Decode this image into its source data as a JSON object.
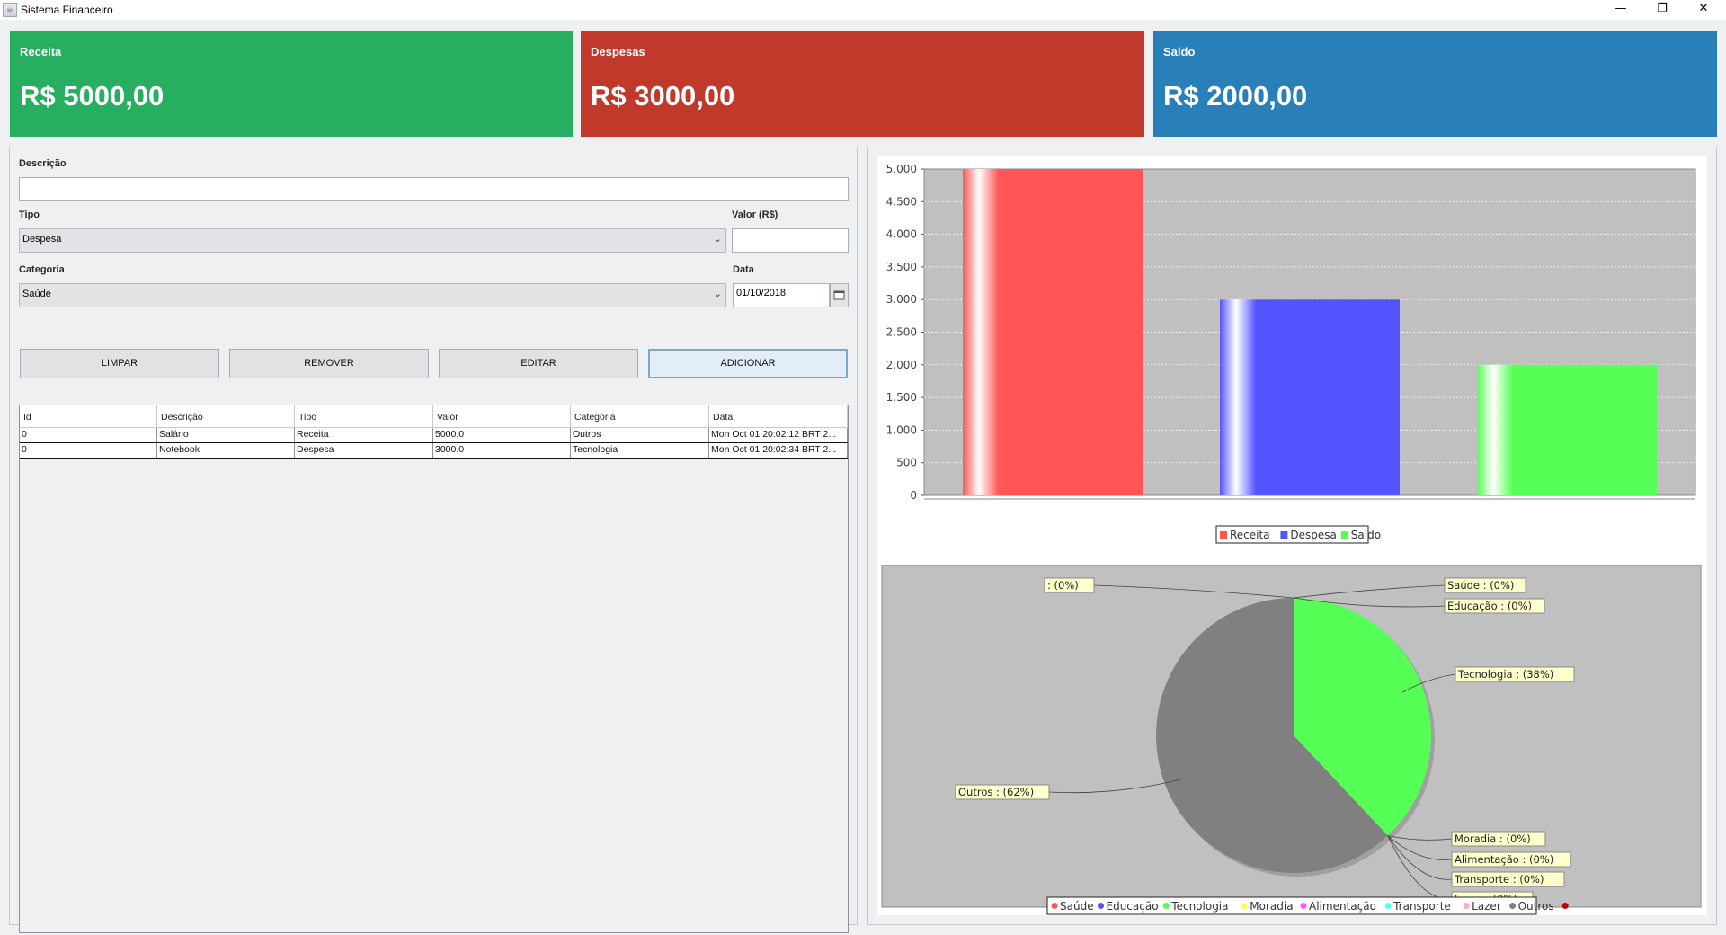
{
  "window": {
    "title": "Sistema Financeiro",
    "controls": [
      "—",
      "❐",
      "✕"
    ]
  },
  "summary_cards": [
    {
      "label": "Receita",
      "value": "R$ 5000,00",
      "color": "#27ae60"
    },
    {
      "label": "Despesas",
      "value": "R$ 3000,00",
      "color": "#c0392b"
    },
    {
      "label": "Saldo",
      "value": "R$ 2000,00",
      "color": "#2980b9"
    }
  ],
  "form": {
    "descricao_label": "Descrição",
    "descricao_value": "",
    "tipo_label": "Tipo",
    "tipo_value": "Despesa",
    "valor_label": "Valor (R$)",
    "valor_value": "",
    "categoria_label": "Categoria",
    "categoria_value": "Saúde",
    "data_label": "Data",
    "data_value": "01/10/2018"
  },
  "buttons": {
    "limpar": "LIMPAR",
    "remover": "REMOVER",
    "editar": "EDITAR",
    "adicionar": "ADICIONAR"
  },
  "table": {
    "columns": [
      "Id",
      "Descrição",
      "Tipo",
      "Valor",
      "Categoria",
      "Data"
    ],
    "rows": [
      [
        "0",
        "Salário",
        "Receita",
        "5000.0",
        "Outros",
        "Mon Oct 01 20:02:12 BRT 2..."
      ],
      [
        "0",
        "Notebook",
        "Despesa",
        "3000.0",
        "Tecnologia",
        "Mon Oct 01 20:02:34 BRT 2..."
      ]
    ]
  },
  "chart_data": [
    {
      "type": "bar",
      "categories": [
        "Receita",
        "Despesa",
        "Saldo"
      ],
      "values": [
        5000,
        3000,
        2000
      ],
      "colors": [
        "#ff5555",
        "#5555ff",
        "#55ff55"
      ],
      "ylim": [
        0,
        5000
      ],
      "yticks": [
        "0",
        "500",
        "1.000",
        "1.500",
        "2.000",
        "2.500",
        "3.000",
        "3.500",
        "4.000",
        "4.500",
        "5.000"
      ],
      "grid": true,
      "legend": "bottom"
    },
    {
      "type": "pie",
      "labels": [
        "Saúde : (0%)",
        "Educação : (0%)",
        "Tecnologia : (38%)",
        "Moradia : (0%)",
        "Alimentação : (0%)",
        "Transporte : (0%)",
        "Lazer : (0%)",
        "Outros : (62%)",
        " : (0%)"
      ],
      "slices": [
        {
          "name": "Tecnologia",
          "percent": 38,
          "color": "#55ff55"
        },
        {
          "name": "Outros",
          "percent": 62,
          "color": "#808080"
        }
      ],
      "legend_items": [
        {
          "name": "Saúde",
          "color": "#ff5555"
        },
        {
          "name": "Educação",
          "color": "#5555ff"
        },
        {
          "name": "Tecnologia",
          "color": "#55ff55"
        },
        {
          "name": "Moradia",
          "color": "#ffff55"
        },
        {
          "name": "Alimentação",
          "color": "#ff55ff"
        },
        {
          "name": "Transporte",
          "color": "#55ffff"
        },
        {
          "name": "Lazer",
          "color": "#ffafaf"
        },
        {
          "name": "Outros",
          "color": "#808080"
        },
        {
          "name": "",
          "color": "#c00000"
        }
      ],
      "legend": "bottom"
    }
  ]
}
